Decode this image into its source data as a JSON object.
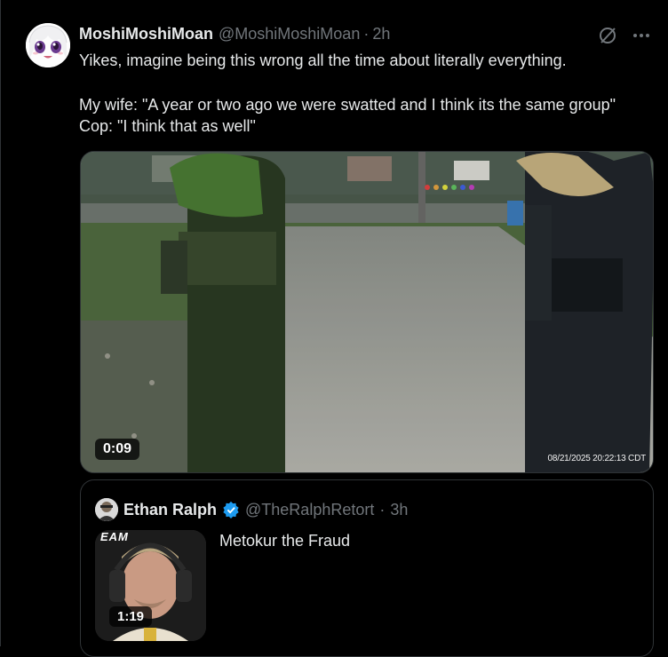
{
  "tweet": {
    "display_name": "MoshiMoshiMoan",
    "handle": "@MoshiMoshiMoan",
    "separator": "·",
    "time": "2h",
    "text_line1": "Yikes, imagine being this wrong all the time about literally everything.",
    "text_line2": "My wife: \"A year or two ago we were swatted and I think its the same group\"",
    "text_line3": "Cop: \"I think that as well\"",
    "icons": [
      "grok-icon",
      "more-icon"
    ]
  },
  "video": {
    "duration": "0:09",
    "timestamp_overlay": "08/21/2025 20:22:13 CDT"
  },
  "quote": {
    "display_name": "Ethan Ralph",
    "handle": "@TheRalphRetort",
    "separator": "·",
    "time": "3h",
    "text": "Metokur the Fraud",
    "thumb_logo": "EAM",
    "thumb_duration": "1:19",
    "verified_color": "#1d9bf0"
  }
}
